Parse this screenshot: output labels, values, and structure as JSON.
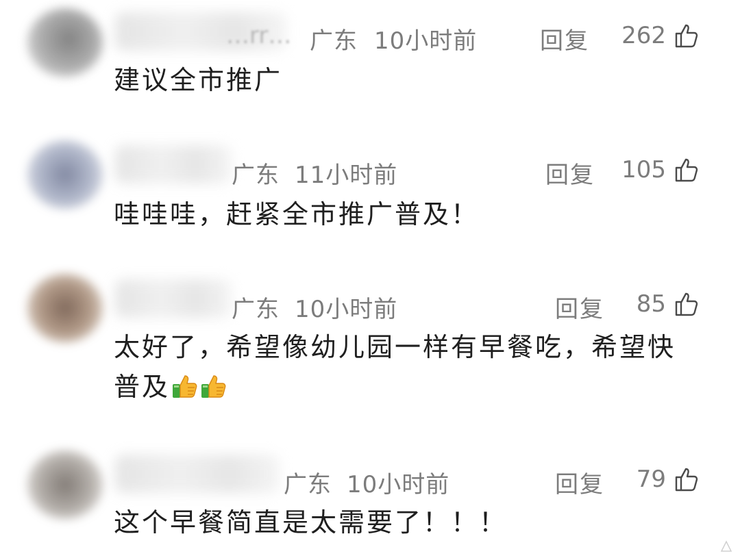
{
  "comments": [
    {
      "name": "…rr…",
      "region": "广东",
      "time": "10小时前",
      "reply_label": "回复",
      "likes": "262",
      "text": "建议全市推广",
      "avatar_color": "#8c8c8c"
    },
    {
      "name": "",
      "region": "广东",
      "time": "11小时前",
      "reply_label": "回复",
      "likes": "105",
      "text": "哇哇哇，赶紧全市推广普及！",
      "avatar_color": "#8a92a8"
    },
    {
      "name": "",
      "region": "广东",
      "time": "10小时前",
      "reply_label": "回复",
      "likes": "85",
      "text_line1": "太好了，希望像幼儿园一样有早餐吃，希望快",
      "text_line2": "普及",
      "emoji": "thumbs-up-emoji",
      "avatar_color": "#8a7060"
    },
    {
      "name": "",
      "region": "广东",
      "time": "10小时前",
      "reply_label": "回复",
      "likes": "79",
      "text": "这个早餐简直是太需要了！！！",
      "avatar_color": "#8e8a86"
    }
  ],
  "icons": {
    "like": "thumbs-up-outline-icon",
    "emoji": "thumbs-up-emoji"
  },
  "colors": {
    "meta_text": "#7c7c7c",
    "body_text": "#1f1f1f",
    "emoji_cuff": "#3fa73a",
    "emoji_hand": "#f7b731"
  }
}
